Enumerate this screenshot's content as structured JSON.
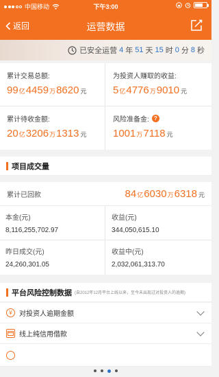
{
  "status_bar": {
    "carrier": "中国移动",
    "time": "下午3:00"
  },
  "nav": {
    "back_label": "返回",
    "title": "运营数据"
  },
  "runtime": {
    "prefix": "已安全运营",
    "years": "4",
    "years_unit": "年",
    "days": "51",
    "days_unit": "天",
    "hours": "15",
    "hours_unit": "时",
    "minutes": "0",
    "minutes_unit": "分",
    "seconds": "8",
    "seconds_unit": "秒"
  },
  "stats": [
    {
      "label": "累计交易总额:",
      "v1": "99",
      "u1": "亿",
      "v2": "4459",
      "u2": "万",
      "v3": "8620",
      "u3": "元"
    },
    {
      "label": "为投资人赚取的收益:",
      "v1": "5",
      "u1": "亿",
      "v2": "4776",
      "u2": "万",
      "v3": "9010",
      "u3": "元"
    },
    {
      "label": "累计待收金额:",
      "v1": "20",
      "u1": "亿",
      "v2": "3206",
      "u2": "万",
      "v3": "1313",
      "u3": "元"
    },
    {
      "label": "风险准备金:",
      "help_icon_text": "?",
      "v1": "1001",
      "u1": "万",
      "v2": "7118",
      "u2": "元"
    }
  ],
  "project": {
    "title": "项目成交量",
    "total_label": "累计已回款",
    "total_v1": "84",
    "total_u1": "亿",
    "total_v2": "6030",
    "total_u2": "万",
    "total_v3": "6318",
    "total_u3": "元",
    "cells": [
      {
        "label": "本金(元)",
        "value": "8,116,255,702.97"
      },
      {
        "label": "收益(元)",
        "value": "344,050,615.10"
      },
      {
        "label": "昨日成交(元)",
        "value": "24,260,301.05"
      },
      {
        "label": "收益中(元)",
        "value": "2,032,061,313.70"
      }
    ]
  },
  "risk": {
    "title": "平台风险控制数据",
    "note": "(自2012年12月平台上线以来，至今未出现过对投资人的逾期)",
    "items": [
      {
        "icon_text": "¥",
        "label": "对投资人逾期金额"
      },
      {
        "icon_text": "",
        "label": "线上纯信用借款"
      }
    ]
  },
  "colors": {
    "accent": "#f37021",
    "blue": "#2f73c8"
  },
  "pager": {
    "count": 4,
    "active": 2
  }
}
